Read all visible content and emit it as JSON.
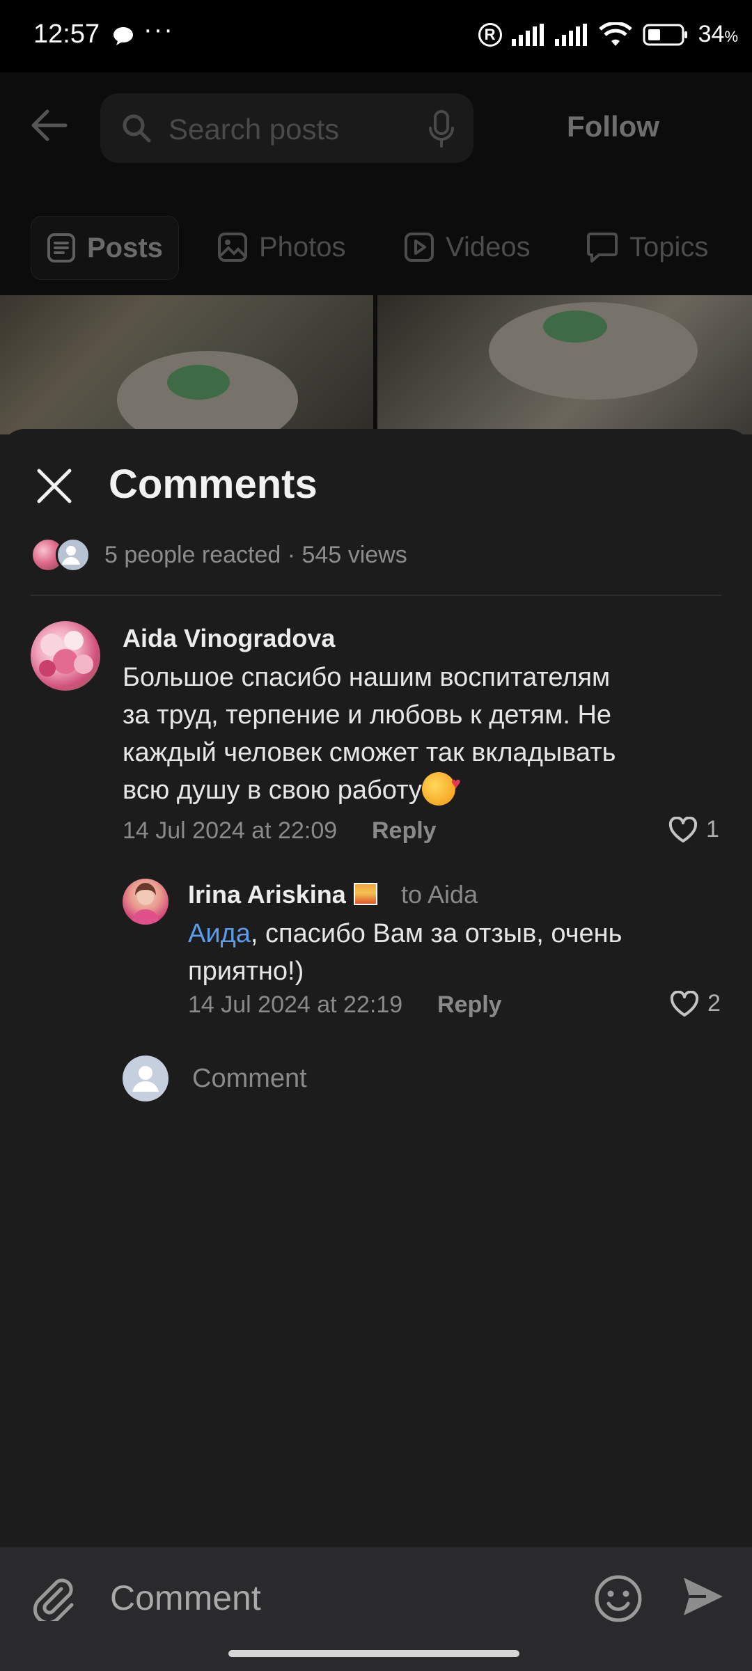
{
  "status_bar": {
    "time": "12:57",
    "battery": "34",
    "battery_unit": "%",
    "registered_mark": "R"
  },
  "background": {
    "search_placeholder": "Search posts",
    "follow_label": "Follow",
    "tabs": [
      {
        "label": "Posts",
        "icon": "posts-icon",
        "active": true
      },
      {
        "label": "Photos",
        "icon": "photos-icon"
      },
      {
        "label": "Videos",
        "icon": "videos-icon"
      },
      {
        "label": "Topics",
        "icon": "topics-icon"
      }
    ]
  },
  "sheet": {
    "title": "Comments",
    "reactions_summary": "5 people reacted · 545 views",
    "comments": [
      {
        "author": "Aida Vinogradova",
        "text_lines": [
          "Большое спасибо нашим воспитателям",
          "за труд, терпение и любовь к детям. Не",
          "каждый человек сможет так вкладывать",
          "всю душу в свою работу"
        ],
        "emoji": "smiling-face-with-hearts",
        "date": "14 Jul 2024 at 22:09",
        "reply_label": "Reply",
        "likes": "1"
      },
      {
        "author": "Irina Ariskina",
        "badge": "sunset-emoji",
        "reply_to": "to Aida",
        "mention": "Аида",
        "text_line1_rest": ", спасибо Вам за отзыв, очень",
        "text_line2": "приятно!)",
        "date": "14 Jul 2024 at 22:19",
        "reply_label": "Reply",
        "likes": "2"
      }
    ],
    "new_comment_placeholder": "Comment"
  },
  "composer": {
    "placeholder": "Comment"
  },
  "colors": {
    "background": "#1c1c1d",
    "mention": "#5b9bea",
    "composer": "#2a2a2c"
  }
}
